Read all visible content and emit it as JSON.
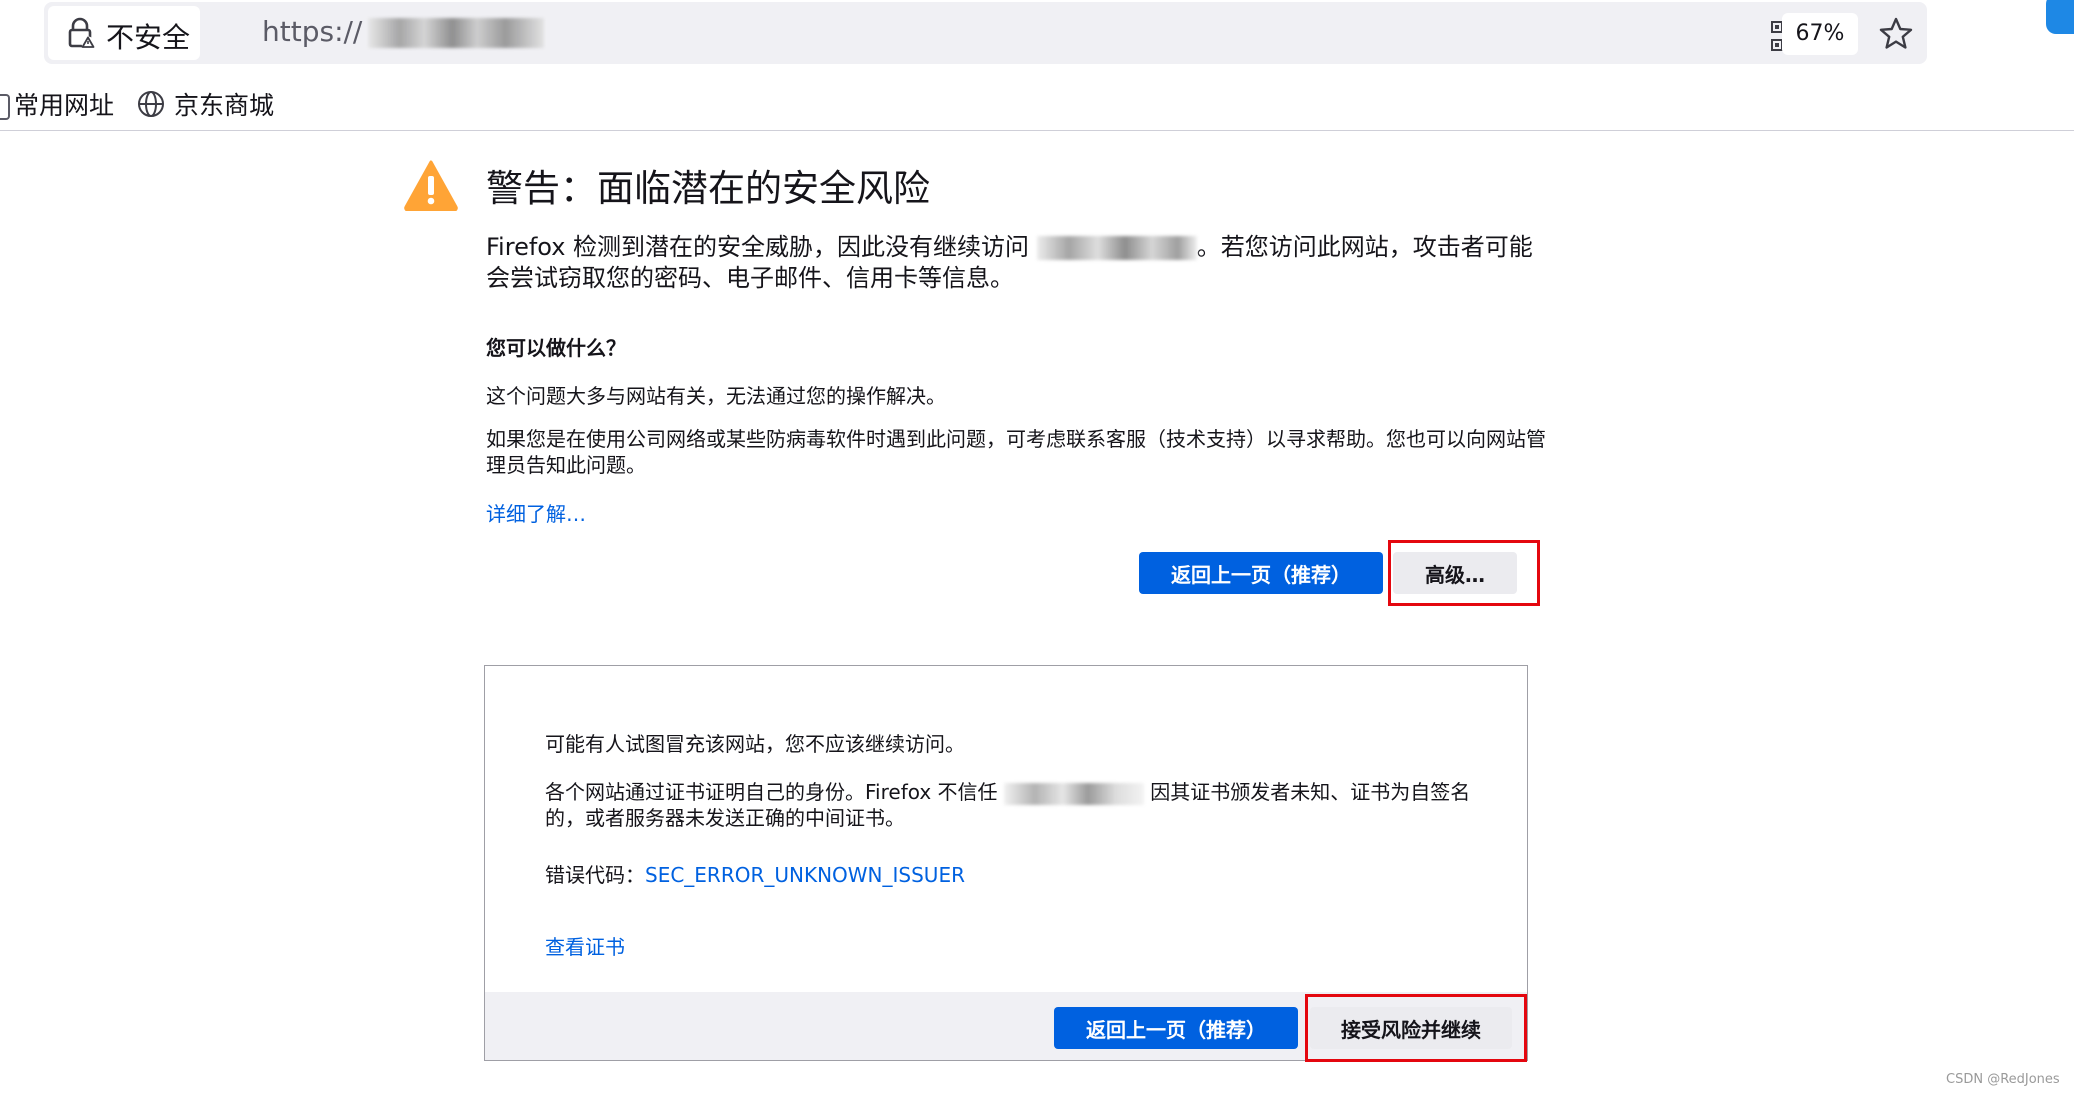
{
  "browser": {
    "security_label": "不安全",
    "url_prefix": "https://",
    "zoom": "67%",
    "bookmarks": [
      {
        "label": "常用网址"
      },
      {
        "label": "京东商城"
      }
    ]
  },
  "error_page": {
    "heading": "警告：面临潜在的安全风险",
    "description_part1": "Firefox 检测到潜在的安全威胁，因此没有继续访问",
    "description_part2": "。若您访问此网站，攻击者可能会尝试窃取您的密码、电子邮件、信用卡等信息。",
    "what_can_you_do": "您可以做什么？",
    "para1": "这个问题大多与网站有关，无法通过您的操作解决。",
    "para2": "如果您是在使用公司网络或某些防病毒软件时遇到此问题，可考虑联系客服（技术支持）以寻求帮助。您也可以向网站管理员告知此问题。",
    "learn_more": "详细了解…",
    "go_back_button": "返回上一页（推荐）",
    "advanced_button": "高级…"
  },
  "advanced_panel": {
    "text1": "可能有人试图冒充该网站，您不应该继续访问。",
    "text2_part1": "各个网站通过证书证明自己的身份。Firefox 不信任",
    "text2_part2": "因其证书颁发者未知、证书为自签名的，或者服务器未发送正确的中间证书。",
    "error_code_label": "错误代码：",
    "error_code": "SEC_ERROR_UNKNOWN_ISSUER",
    "view_certificate": "查看证书",
    "go_back_button": "返回上一页（推荐）",
    "accept_button": "接受风险并继续"
  },
  "watermark": "CSDN @RedJones",
  "colors": {
    "accent_blue": "#0061e0",
    "warning_orange": "#ffa436",
    "highlight_red": "#e4070f"
  }
}
